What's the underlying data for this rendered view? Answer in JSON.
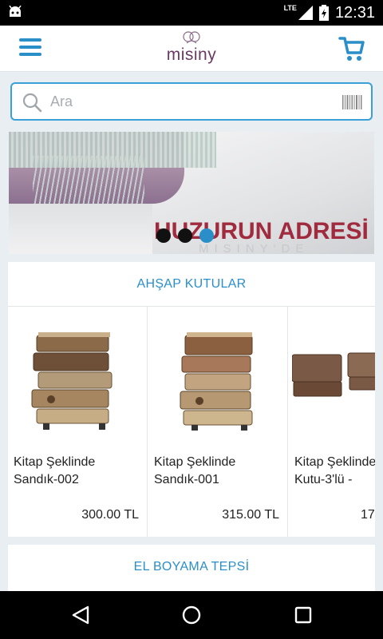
{
  "status_bar": {
    "time": "12:31",
    "network": "LTE"
  },
  "app_bar": {
    "logo_text": "misiny"
  },
  "search": {
    "placeholder": "Ara"
  },
  "banner": {
    "headline": "HUZURUN ADRESİ",
    "subline": "MISINY'DE",
    "slide_count": 3,
    "active_slide": 3
  },
  "sections": [
    {
      "title": "AHŞAP KUTULAR",
      "products": [
        {
          "name": "Kitap Şeklinde\nSandık-002",
          "price": "300.00 TL"
        },
        {
          "name": "Kitap Şeklinde\nSandık-001",
          "price": "315.00 TL"
        },
        {
          "name": "Kitap Şeklinde\nKutu-3'lü -",
          "price": "17"
        }
      ]
    },
    {
      "title": "EL BOYAMA TEPSİ"
    }
  ],
  "colors": {
    "accent": "#2a8fc9",
    "brand": "#6b3a62",
    "banner_text": "#a02b3f"
  },
  "icons": [
    "android-icon",
    "signal-icon",
    "battery-icon",
    "menu-icon",
    "cart-icon",
    "search-icon",
    "barcode-icon",
    "back-icon",
    "home-icon",
    "recents-icon"
  ]
}
